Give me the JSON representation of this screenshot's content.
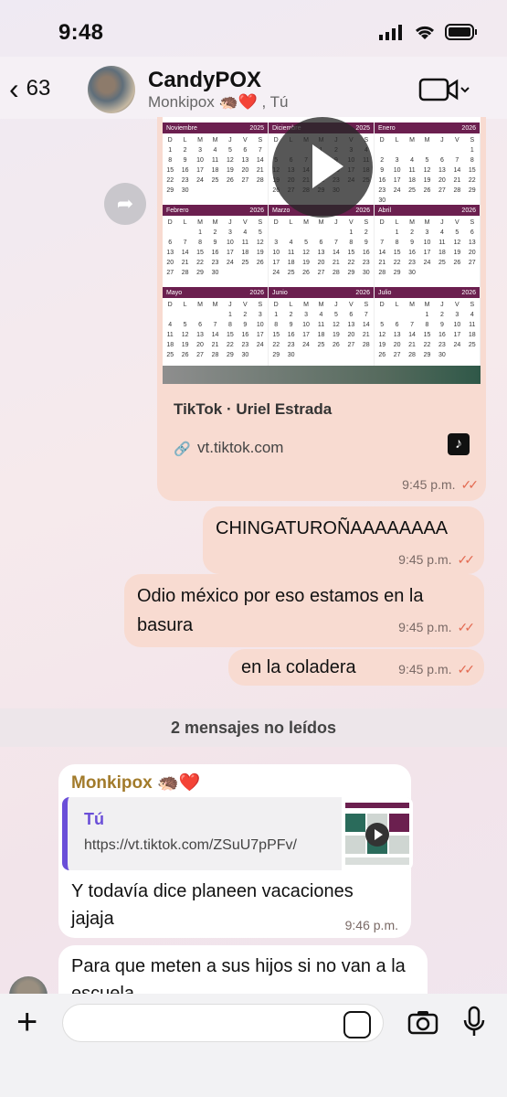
{
  "status": {
    "time": "9:48"
  },
  "header": {
    "back_count": "63",
    "title": "CandyPOX",
    "subtitle": "Monkipox 🦔❤️ , Tú"
  },
  "link_preview": {
    "site": "TikTok · Uriel Estrada",
    "url": "vt.tiktok.com",
    "time": "9:45 p.m.",
    "calendar_months": [
      {
        "name": "Noviembre",
        "year": "2025"
      },
      {
        "name": "Diciembre",
        "year": "2025"
      },
      {
        "name": "Enero",
        "year": "2026"
      },
      {
        "name": "Febrero",
        "year": "2026"
      },
      {
        "name": "Marzo",
        "year": "2026"
      },
      {
        "name": "Abril",
        "year": "2026"
      },
      {
        "name": "Mayo",
        "year": "2026"
      },
      {
        "name": "Junio",
        "year": "2026"
      },
      {
        "name": "Julio",
        "year": "2026"
      }
    ]
  },
  "outgoing": [
    {
      "text": "CHINGATUROÑAAAAAAAA",
      "time": "9:45 p.m."
    },
    {
      "text": "Odio méxico por eso estamos en la basura",
      "time": "9:45 p.m."
    },
    {
      "text": "en la coladera",
      "time": "9:45 p.m."
    }
  ],
  "divider": "2 mensajes no leídos",
  "incoming": {
    "sender": "Monkipox 🦔❤️",
    "quote_name": "Tú",
    "quote_url": "https://vt.tiktok.com/ZSuU7pPFv/",
    "text": "Y todavía dice planeen vacaciones jajaja",
    "time": "9:46 p.m."
  },
  "incoming2": {
    "text": "Para que meten a sus hijos si no van a la escuela"
  },
  "input": {
    "placeholder": ""
  }
}
